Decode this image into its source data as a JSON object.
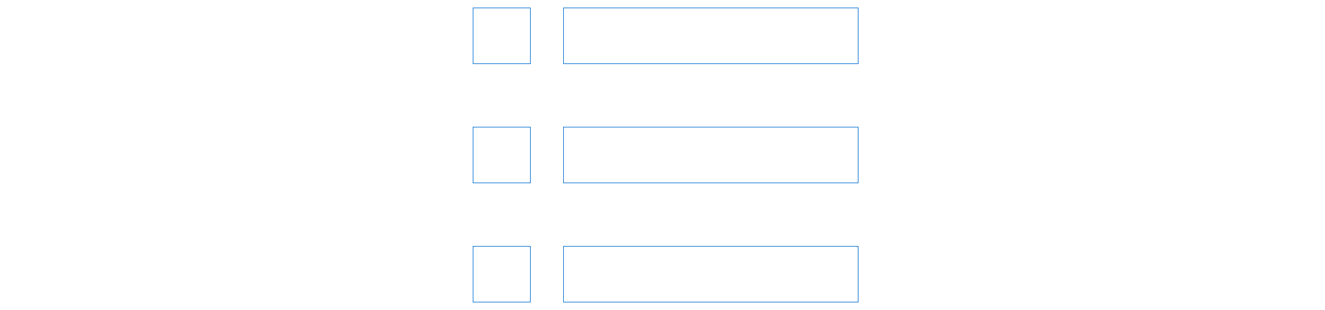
{
  "colors": {
    "background": "#ffffff",
    "outline": "#1f7fd8"
  },
  "rows": [
    {
      "thumbnail": "",
      "content": ""
    },
    {
      "thumbnail": "",
      "content": ""
    },
    {
      "thumbnail": "",
      "content": ""
    }
  ]
}
